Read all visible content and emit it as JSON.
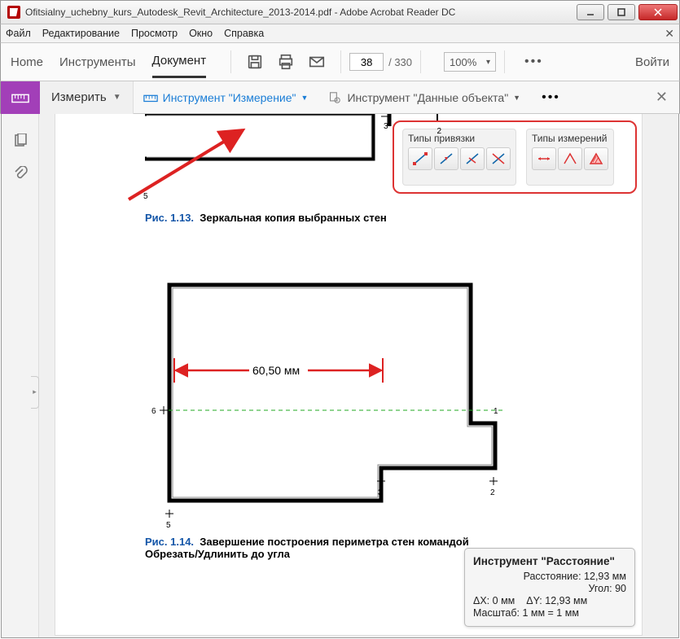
{
  "window": {
    "title": "Ofitsialny_uchebny_kurs_Autodesk_Revit_Architecture_2013-2014.pdf - Adobe Acrobat Reader DC"
  },
  "menu": {
    "file": "Файл",
    "edit": "Редактирование",
    "view": "Просмотр",
    "window": "Окно",
    "help": "Справка"
  },
  "toolbar": {
    "home": "Home",
    "tools": "Инструменты",
    "document": "Документ",
    "page": "38",
    "pages": "/ 330",
    "zoom": "100%",
    "signin": "Войти"
  },
  "sub": {
    "measure": "Измерить",
    "measure_tool": "Инструмент \"Измерение\"",
    "object_tool": "Инструмент \"Данные объекта\""
  },
  "fig13": {
    "label": "Рис. 1.13.",
    "caption": "Зеркальная копия выбранных стен",
    "marks": {
      "n3": "3",
      "n2": "2",
      "n5": "5"
    }
  },
  "snap": {
    "group1": "Типы привязки",
    "group2": "Типы измерений"
  },
  "fig14": {
    "label": "Рис. 1.14.",
    "caption": "Завершение построения периметра стен командой Обрезать/Удлинить до угла",
    "dim": "60,50 мм",
    "marks": {
      "n6": "6",
      "n1": "1",
      "n3": "3",
      "n2": "2",
      "n5": "5"
    }
  },
  "dist": {
    "title": "Инструмент \"Расстояние\"",
    "distance_label": "Расстояние:",
    "distance_val": "12,93 мм",
    "angle_label": "Угол:",
    "angle_val": "90",
    "dx_label": "ΔX:",
    "dx_val": "0 мм",
    "dy_label": "ΔY:",
    "dy_val": "12,93 мм",
    "scale_label": "Масштаб:",
    "scale_val": "1 мм = 1 мм"
  }
}
